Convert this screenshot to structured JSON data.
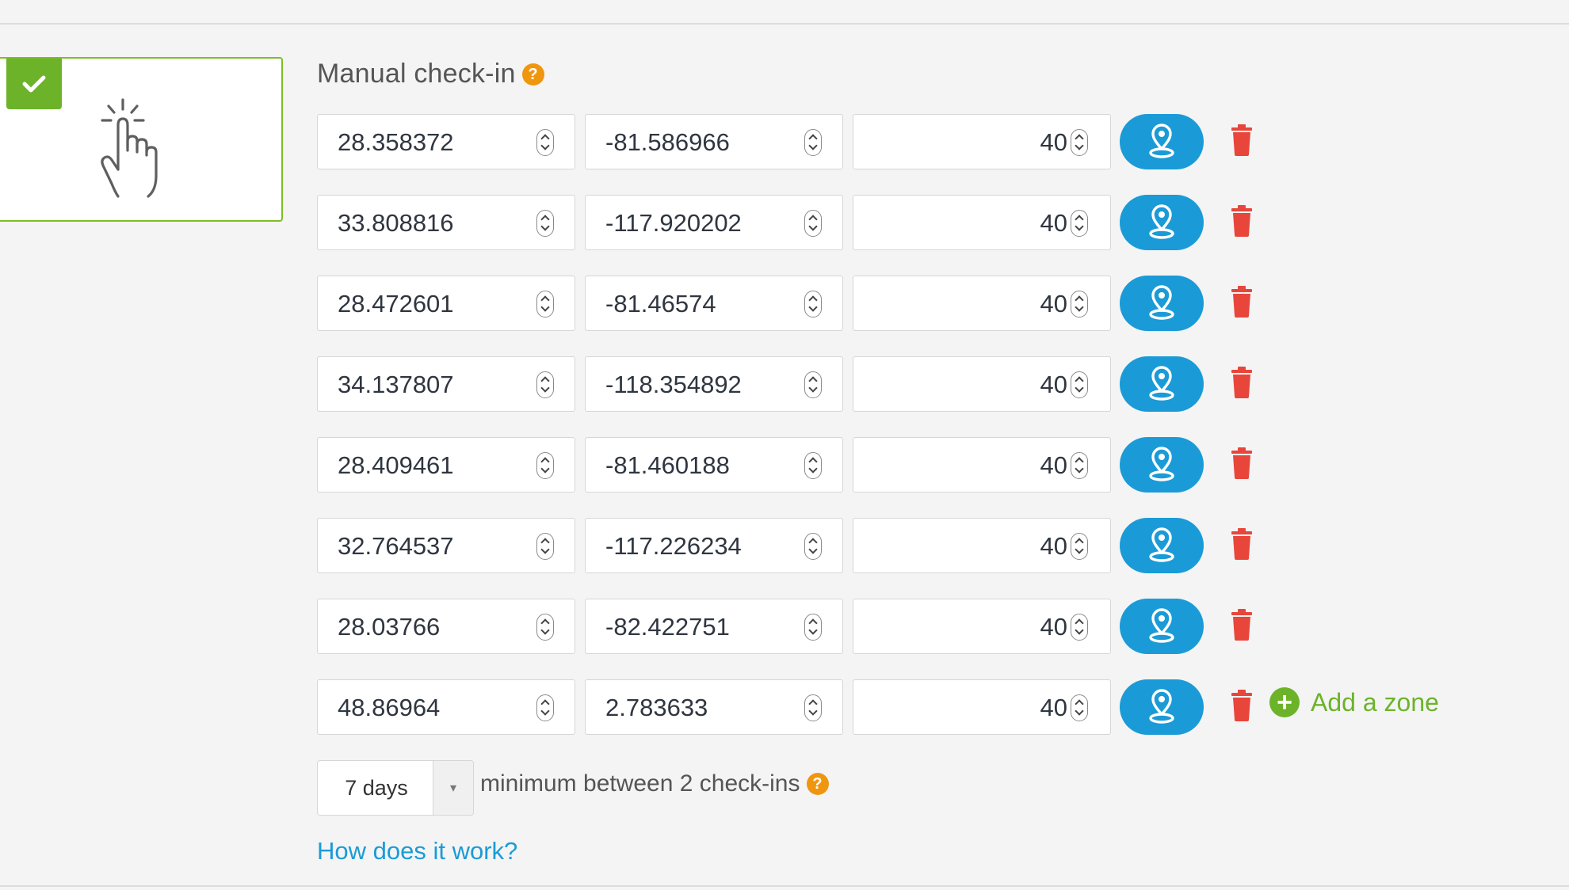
{
  "section": {
    "title": "Manual check-in",
    "help_icon": "?"
  },
  "method_card": {
    "selected_icon": "check-icon",
    "icon": "hand-pointer-icon"
  },
  "zones": [
    {
      "latitude": "28.358372",
      "longitude": "-81.586966",
      "radius": "40"
    },
    {
      "latitude": "33.808816",
      "longitude": "-117.920202",
      "radius": "40"
    },
    {
      "latitude": "28.472601",
      "longitude": "-81.46574",
      "radius": "40"
    },
    {
      "latitude": "34.137807",
      "longitude": "-118.354892",
      "radius": "40"
    },
    {
      "latitude": "28.409461",
      "longitude": "-81.460188",
      "radius": "40"
    },
    {
      "latitude": "32.764537",
      "longitude": "-117.226234",
      "radius": "40"
    },
    {
      "latitude": "28.03766",
      "longitude": "-82.422751",
      "radius": "40"
    },
    {
      "latitude": "48.86964",
      "longitude": "2.783633",
      "radius": "40"
    }
  ],
  "add_zone_label": "Add a zone",
  "frequency": {
    "selected": "7 days",
    "label": "minimum between 2 check-ins",
    "help_icon": "?"
  },
  "how_link": "How does it work?",
  "colors": {
    "accent_green": "#6cb32a",
    "map_button_blue": "#1a9bd7",
    "delete_red": "#e8463b",
    "help_orange": "#f0960e"
  }
}
